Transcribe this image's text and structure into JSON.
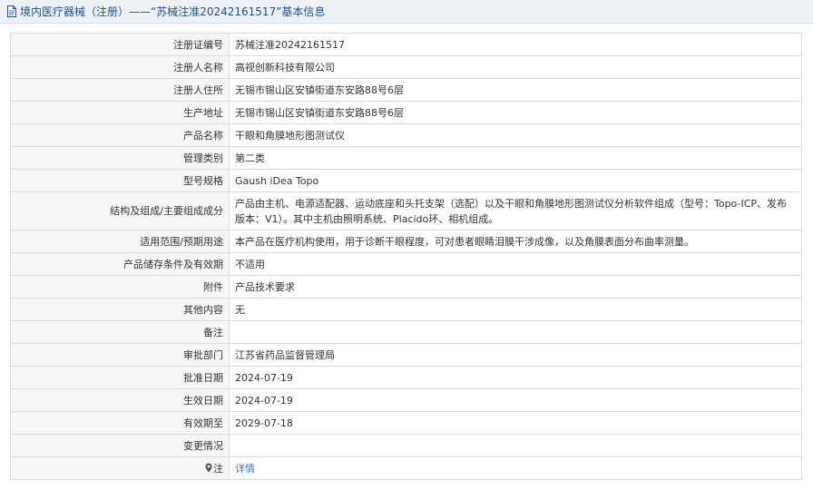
{
  "header": {
    "title": "境内医疗器械（注册）——“苏械注准20242161517”基本信息"
  },
  "rows": [
    {
      "label": "注册证编号",
      "value": "苏械注准20242161517"
    },
    {
      "label": "注册人名称",
      "value": "高视创新科技有限公司"
    },
    {
      "label": "注册人住所",
      "value": "无锡市锡山区安镇街道东安路88号6层"
    },
    {
      "label": "生产地址",
      "value": "无锡市锡山区安镇街道东安路88号6层"
    },
    {
      "label": "产品名称",
      "value": "干眼和角膜地形图测试仪"
    },
    {
      "label": "管理类别",
      "value": "第二类"
    },
    {
      "label": "型号规格",
      "value": "Gaush iDea Topo"
    },
    {
      "label": "结构及组成/主要组成成分",
      "value": "产品由主机、电源适配器、运动底座和头托支架（选配）以及干眼和角膜地形图测试仪分析软件组成（型号：Topo-ICP、发布版本：V1）。其中主机由照明系统、Placido环、相机组成。"
    },
    {
      "label": "适用范围/预期用途",
      "value": "本产品在医疗机构使用，用于诊断干眼程度，可对患者眼睛泪膜干涉成像，以及角膜表面分布曲率测量。"
    },
    {
      "label": "产品储存条件及有效期",
      "value": "不适用"
    },
    {
      "label": "附件",
      "value": "产品技术要求"
    },
    {
      "label": "其他内容",
      "value": "无"
    },
    {
      "label": "备注",
      "value": ""
    },
    {
      "label": "审批部门",
      "value": "江苏省药品监督管理局"
    },
    {
      "label": "批准日期",
      "value": "2024-07-19"
    },
    {
      "label": "生效日期",
      "value": "2024-07-19"
    },
    {
      "label": "有效期至",
      "value": "2029-07-18"
    },
    {
      "label": "变更情况",
      "value": ""
    }
  ],
  "note": {
    "label": "注",
    "link_text": "详情"
  }
}
